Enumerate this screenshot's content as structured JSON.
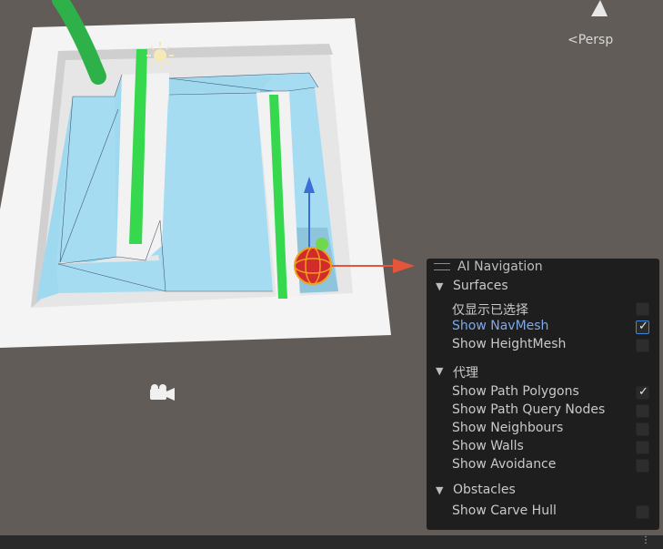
{
  "scene": {
    "view_label": "<Persp"
  },
  "panel": {
    "title": "AI Navigation",
    "sections": [
      {
        "label": "Surfaces"
      },
      {
        "label": "代理"
      },
      {
        "label": "Obstacles"
      }
    ],
    "items": [
      {
        "label": "仅显示已选择",
        "checked": false
      },
      {
        "label": "Show NavMesh",
        "checked": true,
        "highlighted": true
      },
      {
        "label": "Show HeightMesh",
        "checked": false
      },
      {
        "label": "Show Path Polygons",
        "checked": true
      },
      {
        "label": "Show Path Query Nodes",
        "checked": false
      },
      {
        "label": "Show Neighbours",
        "checked": false
      },
      {
        "label": "Show Walls",
        "checked": false
      },
      {
        "label": "Show Avoidance",
        "checked": false
      },
      {
        "label": "Show Carve Hull",
        "checked": false
      }
    ]
  },
  "status": {
    "menu_glyph": "⋮"
  }
}
